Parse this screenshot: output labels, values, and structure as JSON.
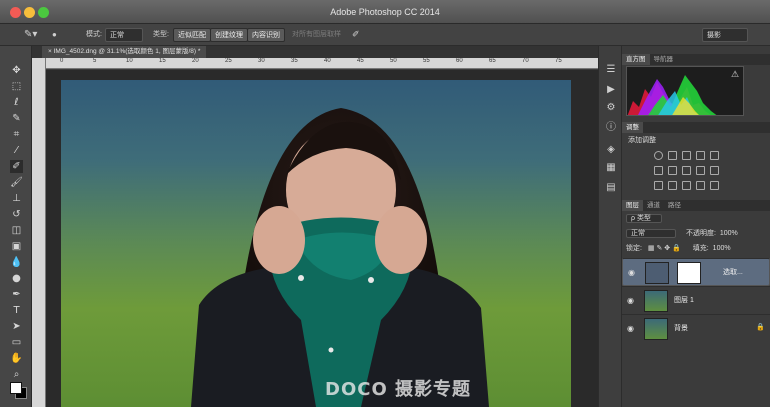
{
  "app": {
    "title": "Adobe Photoshop CC 2014"
  },
  "options_bar": {
    "mode_label": "模式:",
    "mode_value": "正常",
    "type_label": "类型:",
    "type_btn1": "近似匹配",
    "type_btn2": "创建纹理",
    "type_btn3": "内容识别",
    "sample_all": "对所有图层取样",
    "workspace": "摄影"
  },
  "document": {
    "tab_title": "IMG_4502.dng @ 31.1%(选取颜色 1, 图层蒙版/8) *",
    "ruler_marks": [
      "0",
      "5",
      "10",
      "15",
      "20",
      "25",
      "30",
      "35",
      "40",
      "45",
      "50",
      "55",
      "60",
      "65",
      "70",
      "75"
    ],
    "watermark": "DOCO 摄影专题"
  },
  "panels": {
    "histogram_tabs": [
      "直方图",
      "导航器"
    ],
    "adjustments_tab": "调整",
    "adjustments_title": "添加调整",
    "layers_tabs": [
      "图层",
      "通道",
      "路径"
    ],
    "kind_value": "类型",
    "blend_value": "正常",
    "opacity_label": "不透明度:",
    "opacity_value": "100%",
    "lock_label": "锁定:",
    "fill_label": "填充:",
    "fill_value": "100%",
    "layers": [
      {
        "name": "选取..."
      },
      {
        "name": "图层 1"
      },
      {
        "name": "背景"
      }
    ]
  }
}
